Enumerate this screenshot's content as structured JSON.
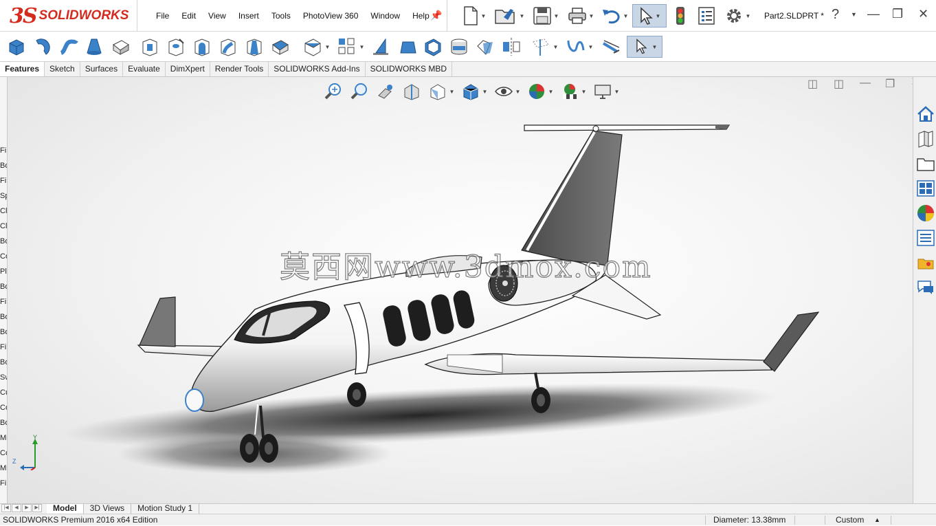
{
  "app": {
    "logo_ds": "3S",
    "logo_text": "SOLIDWORKS",
    "document_name": "Part2.SLDPRT *"
  },
  "menu": [
    "File",
    "Edit",
    "View",
    "Insert",
    "Tools",
    "PhotoView 360",
    "Window",
    "Help"
  ],
  "help_label": "?",
  "tabs": [
    {
      "label": "Features",
      "active": true
    },
    {
      "label": "Sketch",
      "active": false
    },
    {
      "label": "Surfaces",
      "active": false
    },
    {
      "label": "Evaluate",
      "active": false
    },
    {
      "label": "DimXpert",
      "active": false
    },
    {
      "label": "Render Tools",
      "active": false
    },
    {
      "label": "SOLIDWORKS Add-Ins",
      "active": false
    },
    {
      "label": "SOLIDWORKS MBD",
      "active": false
    }
  ],
  "feature_tree_fragments": [
    "Fi",
    "Bo",
    "Fi",
    "Sp",
    "Cl",
    "Cl",
    "Bo",
    "Co",
    "Pl",
    "Bo",
    "Fi",
    "Bo",
    "Bo",
    "Fi",
    "Bo",
    "Sw",
    "Cu",
    "Co",
    "Bo",
    "Mi",
    "Co",
    "Mi",
    "Fi"
  ],
  "viewport": {
    "watermark": "莫西网www.3dmox.com",
    "triad": {
      "y": "Y",
      "z": "Z"
    }
  },
  "bottom_tabs": [
    {
      "label": "Model",
      "active": true
    },
    {
      "label": "3D Views",
      "active": false
    },
    {
      "label": "Motion Study 1",
      "active": false
    }
  ],
  "status": {
    "edition": "SOLIDWORKS Premium 2016 x64 Edition",
    "diameter": "Diameter: 13.38mm",
    "units": "Custom",
    "units_arrow": "▲"
  },
  "colors": {
    "brand_red": "#d52b1e",
    "icon_blue": "#2b6cb5",
    "viewport_bg": "#ececec"
  }
}
